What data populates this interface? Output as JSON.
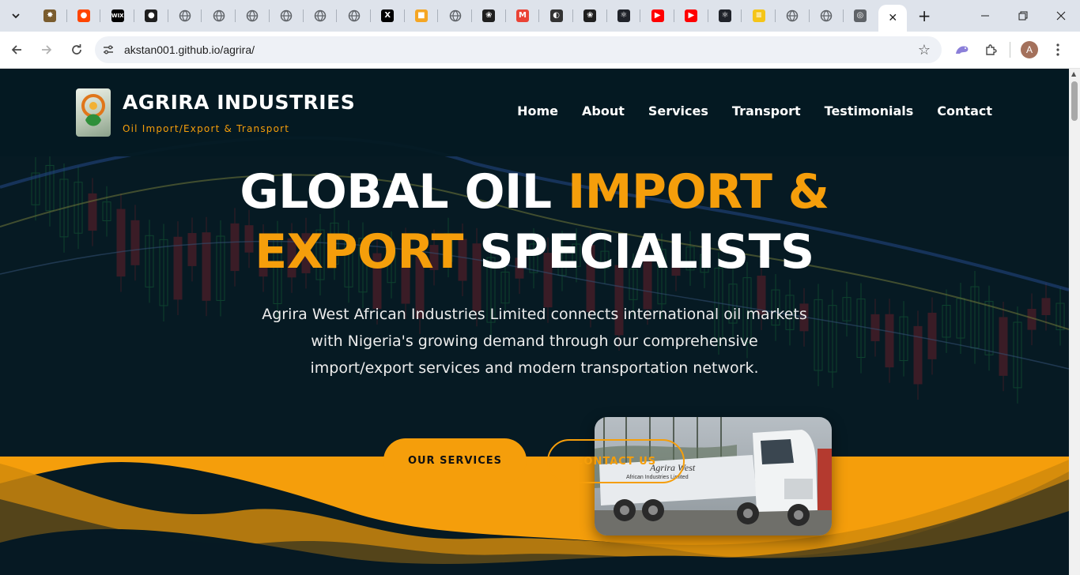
{
  "browser": {
    "tabs": [
      {
        "icon": "seal-favicon-icon",
        "color": "#7a5c2e",
        "glyph": "✸"
      },
      {
        "icon": "reddit-favicon-icon",
        "color": "#ff4500",
        "glyph": "●"
      },
      {
        "icon": "wix-favicon-icon",
        "color": "#000000",
        "glyph": "WIX"
      },
      {
        "icon": "github-favicon-icon",
        "color": "#1f1f1f",
        "glyph": "●"
      },
      {
        "icon": "globe-icon",
        "color": "#5f6368",
        "glyph": ""
      },
      {
        "icon": "globe-icon",
        "color": "#5f6368",
        "glyph": ""
      },
      {
        "icon": "globe-icon",
        "color": "#5f6368",
        "glyph": ""
      },
      {
        "icon": "globe-icon",
        "color": "#5f6368",
        "glyph": ""
      },
      {
        "icon": "globe-icon",
        "color": "#5f6368",
        "glyph": ""
      },
      {
        "icon": "globe-icon",
        "color": "#5f6368",
        "glyph": ""
      },
      {
        "icon": "x-favicon-icon",
        "color": "#000000",
        "glyph": "X"
      },
      {
        "icon": "gallery-favicon-icon",
        "color": "#f5a623",
        "glyph": "■"
      },
      {
        "icon": "globe-icon",
        "color": "#5f6368",
        "glyph": ""
      },
      {
        "icon": "openai-favicon-icon",
        "color": "#1f1f1f",
        "glyph": "❀"
      },
      {
        "icon": "gmail-favicon-icon",
        "color": "#ea4335",
        "glyph": "M"
      },
      {
        "icon": "panda-favicon-icon",
        "color": "#333333",
        "glyph": "◐"
      },
      {
        "icon": "openai-favicon-icon",
        "color": "#1f1f1f",
        "glyph": "❀"
      },
      {
        "icon": "react-favicon-icon",
        "color": "#20232a",
        "glyph": "⚛"
      },
      {
        "icon": "youtube-favicon-icon",
        "color": "#ff0000",
        "glyph": "▶"
      },
      {
        "icon": "youtube-favicon-icon",
        "color": "#ff0000",
        "glyph": "▶"
      },
      {
        "icon": "react-favicon-icon",
        "color": "#20232a",
        "glyph": "⚛"
      },
      {
        "icon": "layers-favicon-icon",
        "color": "#f5c518",
        "glyph": "≡"
      },
      {
        "icon": "globe-icon",
        "color": "#5f6368",
        "glyph": ""
      },
      {
        "icon": "globe-icon",
        "color": "#5f6368",
        "glyph": ""
      },
      {
        "icon": "chrome-favicon-icon",
        "color": "#5f6368",
        "glyph": "◎"
      }
    ],
    "close_glyph": "✕",
    "newtab_glyph": "+",
    "url": "akstan001.github.io/agrira/",
    "avatar_letter": "A"
  },
  "site": {
    "brand": {
      "name": "AGRIRA INDUSTRIES",
      "tagline": "Oil Import/Export & Transport"
    },
    "nav": [
      "Home",
      "About",
      "Services",
      "Transport",
      "Testimonials",
      "Contact"
    ],
    "hero": {
      "title_part1": "GLOBAL OIL ",
      "title_accent1": "IMPORT &",
      "title_accent2": "EXPORT",
      "title_part2": " SPECIALISTS",
      "subtitle": "Agrira West African Industries Limited connects international oil markets with Nigeria's growing demand through our comprehensive import/export services and modern transportation network.",
      "cta_primary": "OUR SERVICES",
      "cta_secondary": "CONTACT US",
      "truck_text_line1": "Agrira West",
      "truck_text_line2": "African Industries Limited"
    }
  },
  "colors": {
    "accent": "#f59e0b",
    "page_bg": "#071a24",
    "header_bg": "#041922"
  }
}
